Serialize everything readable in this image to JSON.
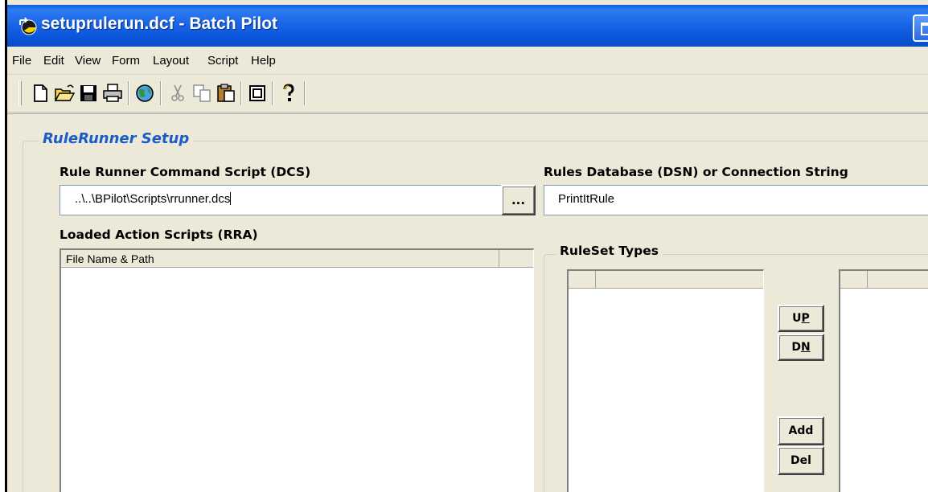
{
  "window": {
    "title": "setuprulerun.dcf - Batch Pilot",
    "app_icon": "batch-pilot-app-icon",
    "maximize_icon": "maximize-icon"
  },
  "menu": {
    "items": [
      "File",
      "Edit",
      "View",
      "Form",
      "Layout",
      "Script",
      "Help"
    ]
  },
  "toolbar": {
    "icons": [
      "new-document-icon",
      "open-folder-icon",
      "save-icon",
      "print-icon",
      "globe-icon",
      "cut-icon",
      "copy-icon",
      "paste-icon",
      "window-icon",
      "help-icon"
    ]
  },
  "setup": {
    "group_title": "RuleRunner Setup",
    "command_script_label": "Rule Runner Command Script (DCS)",
    "command_script_value": "..\\..\\BPilot\\Scripts\\rrunner.dcs",
    "browse_label": "...",
    "rules_db_label": "Rules Database (DSN) or Connection String",
    "rules_db_value": "PrintItRule",
    "loaded_scripts_label": "Loaded Action Scripts (RRA)",
    "loaded_scripts_columns": [
      "File Name & Path",
      ""
    ],
    "ruleset_group_title": "RuleSet Types",
    "buttons": {
      "up_prefix": "U",
      "up_mnemonic": "P",
      "dn_prefix": "D",
      "dn_mnemonic": "N",
      "add": "Add",
      "del": "Del"
    }
  },
  "colors": {
    "title_bar": "#1a66e6",
    "group_title": "#1a5cc8",
    "face": "#ece9d8"
  }
}
